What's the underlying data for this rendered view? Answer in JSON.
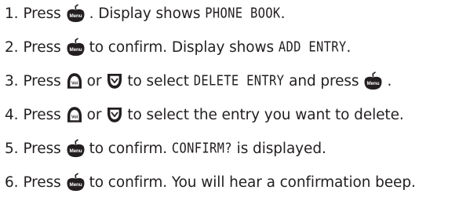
{
  "steps": [
    {
      "number": "1.",
      "parts": [
        "Press",
        "menu",
        ". Display shows ",
        "lcd:PHONE BOOK",
        "."
      ]
    },
    {
      "number": "2.",
      "parts": [
        "Press",
        "menu",
        "to confirm. Display shows ",
        "lcd:ADD ENTRY",
        "."
      ]
    },
    {
      "number": "3.",
      "parts": [
        "Press",
        "vol_up",
        "or",
        "down",
        "to select ",
        "lcd:DELETE ENTRY",
        " and press",
        "menu",
        "."
      ]
    },
    {
      "number": "4.",
      "parts": [
        "Press",
        "vol_up",
        "or",
        "down",
        "to select the entry you want to delete."
      ]
    },
    {
      "number": "5.",
      "parts": [
        "Press",
        "menu",
        "to confirm. ",
        "lcd:CONFIRM?",
        " is displayed."
      ]
    },
    {
      "number": "6.",
      "parts": [
        "Press",
        "menu",
        "to confirm. You will hear a confirmation beep."
      ]
    }
  ],
  "icons": {
    "menu_label": "Menu",
    "vol_label": "Vol",
    "color": "#231f20"
  }
}
